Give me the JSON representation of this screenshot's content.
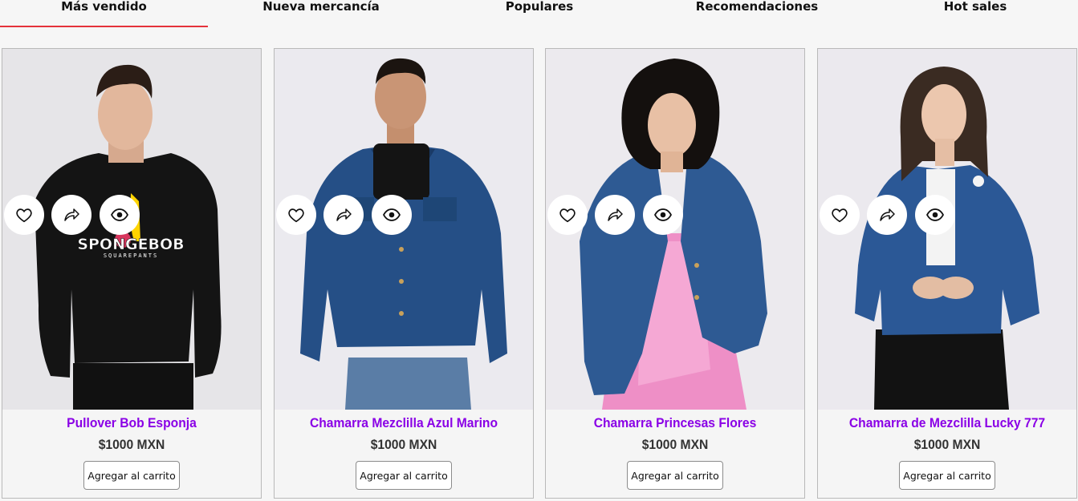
{
  "tabs": [
    {
      "label": "Más vendido",
      "active": true
    },
    {
      "label": "Nueva mercancía",
      "active": false
    },
    {
      "label": "Populares",
      "active": false
    },
    {
      "label": "Recomendaciones",
      "active": false
    },
    {
      "label": "Hot sales",
      "active": false
    }
  ],
  "colors": {
    "tab_underline": "#e5323b",
    "product_name": "#8a00e6",
    "price": "#333333",
    "card_border": "#b9b9b9"
  },
  "card_actions": [
    "heart-icon",
    "share-icon",
    "eye-icon"
  ],
  "products": [
    {
      "name": "Pullover Bob Esponja",
      "price": "$1000 MXN",
      "button": "Agregar al carrito",
      "print_text": "SPONGEBOB",
      "print_subtext": "SQUAREPANTS"
    },
    {
      "name": "Chamarra Mezclilla Azul Marino",
      "price": "$1000 MXN",
      "button": "Agregar al carrito"
    },
    {
      "name": "Chamarra Princesas Flores",
      "price": "$1000 MXN",
      "button": "Agregar al carrito"
    },
    {
      "name": "Chamarra de Mezclilla Lucky 777",
      "price": "$1000 MXN",
      "button": "Agregar al carrito"
    }
  ]
}
